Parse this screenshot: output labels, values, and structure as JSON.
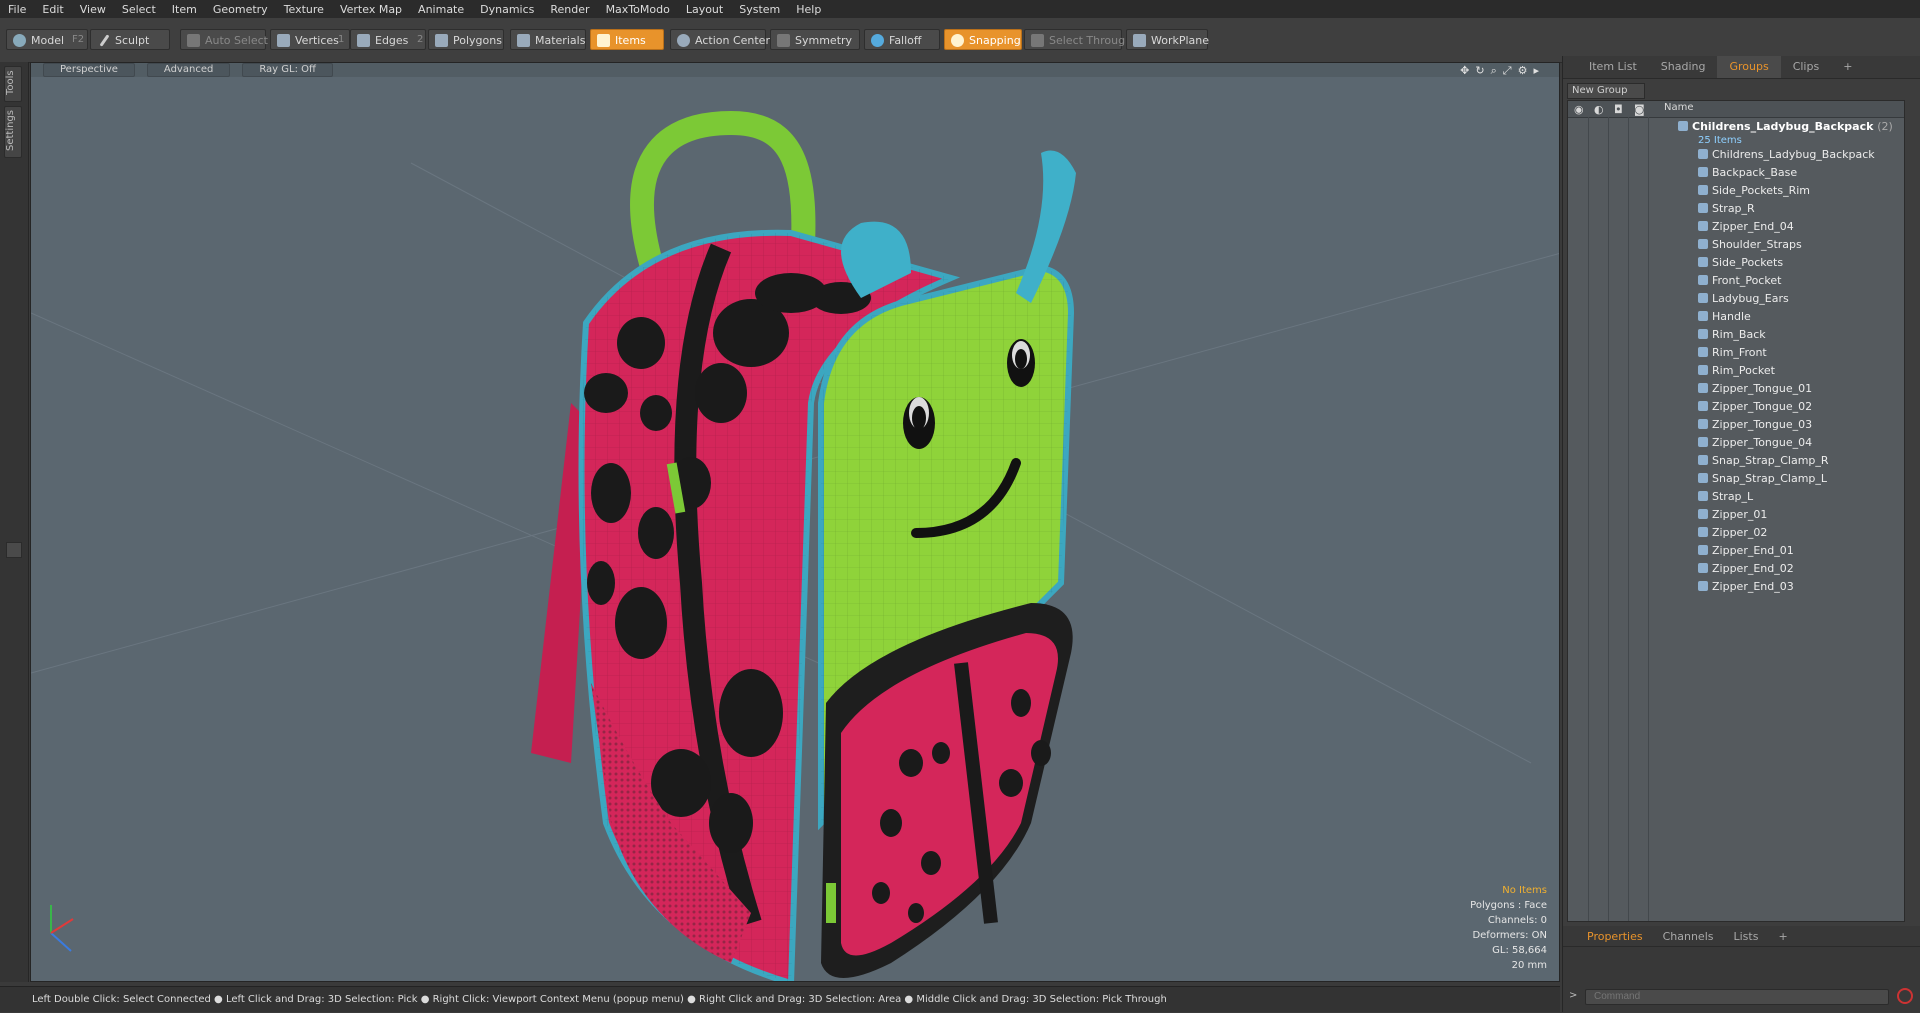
{
  "menu": [
    "File",
    "Edit",
    "View",
    "Select",
    "Item",
    "Geometry",
    "Texture",
    "Vertex Map",
    "Animate",
    "Dynamics",
    "Render",
    "MaxToModo",
    "Layout",
    "System",
    "Help"
  ],
  "toolbar": {
    "model": "Model",
    "model_key": "F2",
    "sculpt": "Sculpt",
    "auto_select": "Auto Select",
    "vertices": "Vertices",
    "vertices_key": "1",
    "edges": "Edges",
    "edges_key": "2",
    "polygons": "Polygons",
    "materials": "Materials",
    "items": "Items",
    "action_center": "Action Center",
    "symmetry": "Symmetry",
    "falloff": "Falloff",
    "snapping": "Snapping",
    "select_through": "Select Through",
    "workplane": "WorkPlane"
  },
  "left_tabs": [
    "Tools",
    "Settings"
  ],
  "viewport": {
    "view": "Perspective",
    "shading": "Advanced",
    "raygl": "Ray GL: Off",
    "info": {
      "no_items": "No Items",
      "polygons": "Polygons : Face",
      "channels": "Channels: 0",
      "deformers": "Deformers: ON",
      "gl": "GL: 58,664",
      "size": "20 mm"
    }
  },
  "status": "Left Double Click: Select Connected ● Left Click and Drag: 3D Selection: Pick ● Right Click: Viewport Context Menu (popup menu) ● Right Click and Drag: 3D Selection: Area ● Middle Click and Drag: 3D Selection: Pick Through",
  "panel": {
    "tabs": [
      "Item List",
      "Shading",
      "Groups",
      "Clips"
    ],
    "active_tab": "Groups",
    "new_group": "New Group",
    "name_col": "Name",
    "root": "Childrens_Ladybug_Backpack",
    "root_count": "(2)",
    "items_count": "25 Items",
    "items": [
      "Childrens_Ladybug_Backpack",
      "Backpack_Base",
      "Side_Pockets_Rim",
      "Strap_R",
      "Zipper_End_04",
      "Shoulder_Straps",
      "Side_Pockets",
      "Front_Pocket",
      "Ladybug_Ears",
      "Handle",
      "Rim_Back",
      "Rim_Front",
      "Rim_Pocket",
      "Zipper_Tongue_01",
      "Zipper_Tongue_02",
      "Zipper_Tongue_03",
      "Zipper_Tongue_04",
      "Snap_Strap_Clamp_R",
      "Snap_Strap_Clamp_L",
      "Strap_L",
      "Zipper_01",
      "Zipper_02",
      "Zipper_End_01",
      "Zipper_End_02",
      "Zipper_End_03"
    ]
  },
  "bottom": {
    "tabs": [
      "Properties",
      "Channels",
      "Lists"
    ],
    "command_placeholder": "Command"
  }
}
